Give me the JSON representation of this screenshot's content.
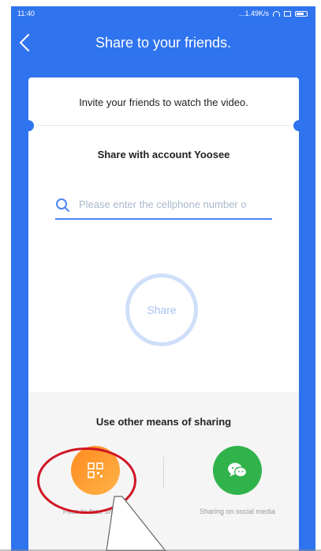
{
  "status_bar": {
    "time": "11:40",
    "net_speed": "...1.49K/s"
  },
  "header": {
    "title": "Share to your friends."
  },
  "card": {
    "invite_text": "Invite your friends to watch the video.",
    "share_heading": "Share with account Yoosee",
    "search": {
      "placeholder": "Please enter the cellphone number o",
      "value": ""
    },
    "share_button_label": "Share"
  },
  "other_sharing": {
    "title": "Use other means of sharing",
    "options": [
      {
        "label": "Face-to-face sharing",
        "icon": "qr-code-icon"
      },
      {
        "label": "Sharing on social media",
        "icon": "wechat-icon"
      }
    ]
  },
  "colors": {
    "primary": "#2f73ee",
    "share_ring": "#cfdef9",
    "face_orange": "#ff8a1f",
    "social_green": "#2fb34a",
    "highlight_red": "#d11524"
  }
}
